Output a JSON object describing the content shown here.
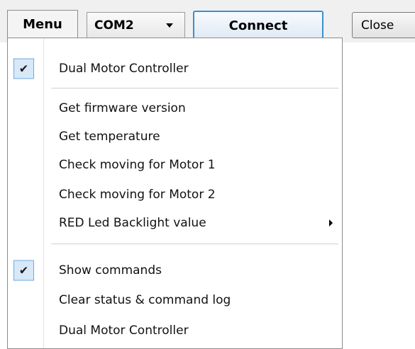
{
  "toolbar": {
    "menu_label": "Menu",
    "port_value": "COM2",
    "connect_label": "Connect",
    "close_label": "Close"
  },
  "menu": {
    "items": [
      {
        "label": "Dual Motor Controller",
        "checked": true
      },
      {
        "label": "Get firmware version"
      },
      {
        "label": "Get temperature"
      },
      {
        "label": "Check moving for Motor 1"
      },
      {
        "label": "Check moving for Motor 2"
      },
      {
        "label": "RED Led Backlight value",
        "submenu": true
      },
      {
        "label": "Show commands",
        "checked": true
      },
      {
        "label": "Clear status & command log"
      },
      {
        "label": "Dual Motor Controller"
      }
    ],
    "check_glyph": "✔"
  },
  "colors": {
    "toolbar_bg": "#f0f0f0",
    "check_bg": "#d7e8f8",
    "check_border": "#6fa9df",
    "connect_border": "#3c8fd0"
  }
}
